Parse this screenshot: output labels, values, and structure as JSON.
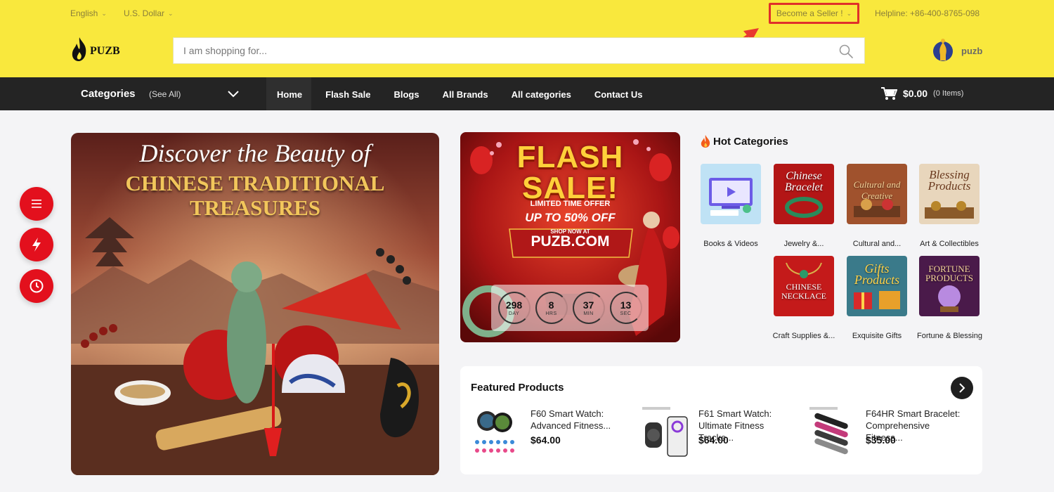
{
  "topbar": {
    "language": "English",
    "currency": "U.S. Dollar",
    "become_seller": "Become a Seller !",
    "helpline": "Helpline: +86-400-8765-098"
  },
  "logo": {
    "text": "PUZB"
  },
  "search": {
    "placeholder": "I am shopping for..."
  },
  "user": {
    "name": "puzb"
  },
  "nav": {
    "categories_label": "Categories",
    "see_all": "(See All)",
    "links": [
      "Home",
      "Flash Sale",
      "Blogs",
      "All Brands",
      "All categories",
      "Contact Us"
    ]
  },
  "cart": {
    "amount": "$0.00",
    "items": "(0 Items)"
  },
  "side_buttons": [
    "menu-icon",
    "flash-icon",
    "clock-icon"
  ],
  "banner": {
    "title": "Discover the Beauty of",
    "subtitle_line1": "CHINESE TRADITIONAL",
    "subtitle_line2": "TREASURES"
  },
  "flash_sale": {
    "title_line1": "FLASH",
    "title_line2": "SALE!",
    "offer": "LIMITED TIME OFFER",
    "discount": "UP TO 50% OFF",
    "shop_now": "SHOP NOW AT",
    "domain": "PUZB.COM",
    "countdown": [
      {
        "value": "298",
        "unit": "DAY"
      },
      {
        "value": "8",
        "unit": "HRS"
      },
      {
        "value": "37",
        "unit": "MIN"
      },
      {
        "value": "13",
        "unit": "SEC"
      }
    ]
  },
  "hot_categories": {
    "title": "Hot Categories",
    "items": [
      {
        "label": "Books & Videos",
        "thumb_text": ""
      },
      {
        "label": "Jewelry &...",
        "thumb_text": "Chinese Bracelet"
      },
      {
        "label": "Cultural and...",
        "thumb_text": "Cultural and Creative"
      },
      {
        "label": "Art & Collectibles",
        "thumb_text": "Blessing Products"
      },
      {
        "label": "Craft Supplies &...",
        "thumb_text": "CHINESE NECKLACE"
      },
      {
        "label": "Exquisite Gifts",
        "thumb_text": "Gifts Products"
      },
      {
        "label": "Fortune & Blessing",
        "thumb_text": "FORTUNE PRODUCTS"
      }
    ]
  },
  "featured": {
    "title": "Featured Products",
    "products": [
      {
        "name": "F60 Smart Watch: Advanced Fitness...",
        "price": "$64.00"
      },
      {
        "name": "F61 Smart Watch: Ultimate Fitness Tracke...",
        "price": "$64.00"
      },
      {
        "name": "F64HR Smart Bracelet: Comprehensive Fitness...",
        "price": "$35.00"
      }
    ]
  },
  "colors": {
    "topbar_bg": "#f9e83d",
    "nav_bg": "#242424",
    "accent_red": "#e3101d",
    "highlight_box": "#e0302a"
  }
}
